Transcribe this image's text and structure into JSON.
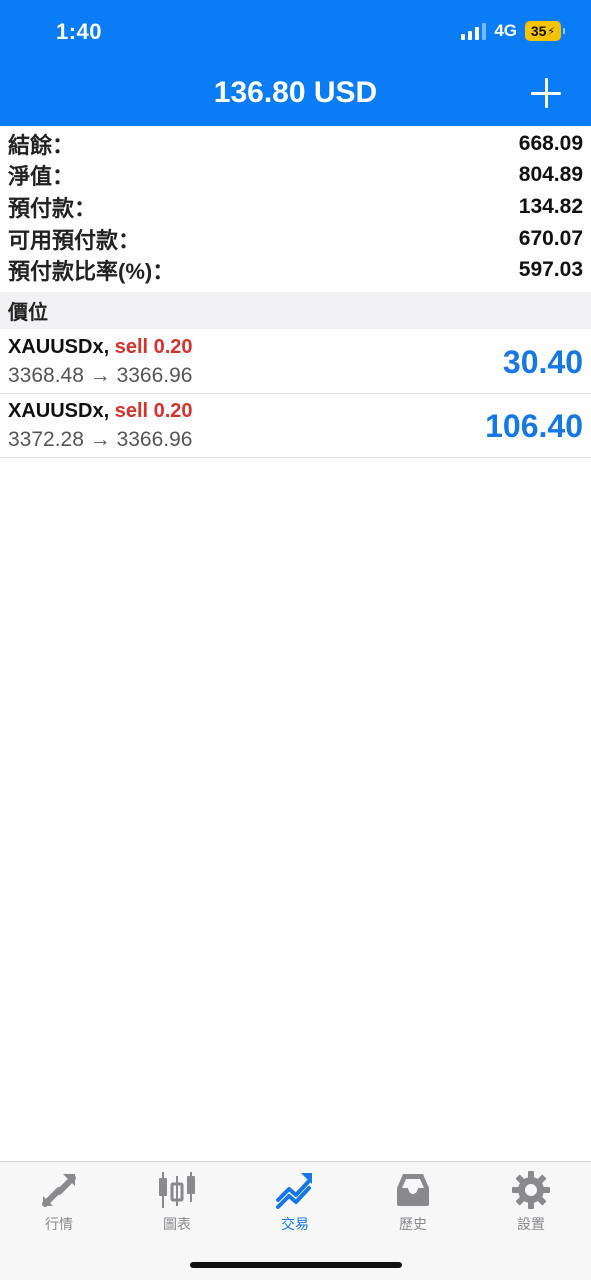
{
  "status_bar": {
    "time": "1:40",
    "network": "4G",
    "battery": "35"
  },
  "header": {
    "balance_title": "136.80 USD"
  },
  "summary": [
    {
      "label": "結餘：",
      "value": "668.09"
    },
    {
      "label": "淨值：",
      "value": "804.89"
    },
    {
      "label": "預付款：",
      "value": "134.82"
    },
    {
      "label": "可用預付款：",
      "value": "670.07"
    },
    {
      "label": "預付款比率(%)：",
      "value": "597.03"
    }
  ],
  "positions_header": "價位",
  "positions": [
    {
      "symbol": "XAUUSDx,",
      "side": "sell 0.20",
      "prices": "3368.48 → 3366.96",
      "profit": "30.40"
    },
    {
      "symbol": "XAUUSDx,",
      "side": "sell 0.20",
      "prices": "3372.28 → 3366.96",
      "profit": "106.40"
    }
  ],
  "tabs": [
    {
      "label": "行情",
      "icon": "quotes-arrows-icon",
      "active": false
    },
    {
      "label": "圖表",
      "icon": "candlestick-chart-icon",
      "active": false
    },
    {
      "label": "交易",
      "icon": "trade-trend-icon",
      "active": true
    },
    {
      "label": "歷史",
      "icon": "history-inbox-icon",
      "active": false
    },
    {
      "label": "設置",
      "icon": "gear-icon",
      "active": false
    }
  ],
  "colors": {
    "accent": "#0a7cf5",
    "sell": "#d8322b",
    "profit": "#1677e8",
    "inactive_icon": "#8a8a8e"
  }
}
